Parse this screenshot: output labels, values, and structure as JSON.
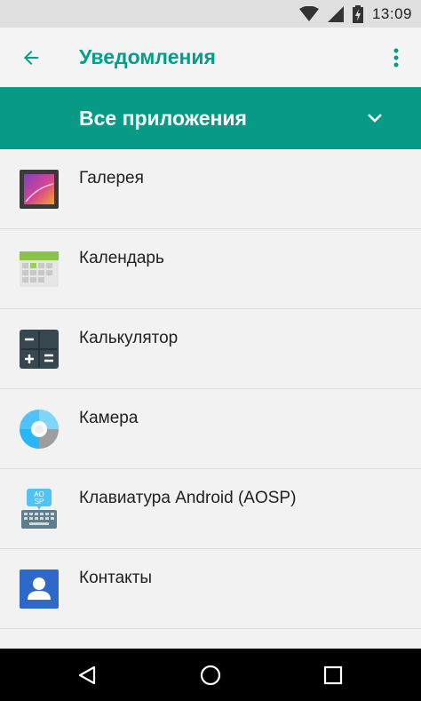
{
  "status_bar": {
    "time": "13:09",
    "icons": [
      "wifi-icon",
      "signal-icon",
      "battery-charging-icon"
    ]
  },
  "toolbar": {
    "back_icon": "arrow-back-icon",
    "title": "Уведомления",
    "more_icon": "more-vert-icon"
  },
  "filter": {
    "selected": "Все приложения",
    "icon": "chevron-down-icon"
  },
  "apps": [
    {
      "label": "Галерея",
      "icon": "gallery-icon"
    },
    {
      "label": "Календарь",
      "icon": "calendar-icon"
    },
    {
      "label": "Калькулятор",
      "icon": "calculator-icon"
    },
    {
      "label": "Камера",
      "icon": "camera-icon"
    },
    {
      "label": "Клавиатура Android (AOSP)",
      "icon": "keyboard-icon"
    },
    {
      "label": "Контакты",
      "icon": "contacts-icon"
    }
  ],
  "navigation": {
    "back": "nav-back-icon",
    "home": "nav-home-icon",
    "recents": "nav-recents-icon"
  },
  "colors": {
    "accent": "#009f8a",
    "filter_bar": "#069a87",
    "background": "#f2f2f2",
    "status_bar": "#e0e0e0",
    "nav_bar": "#000000"
  }
}
